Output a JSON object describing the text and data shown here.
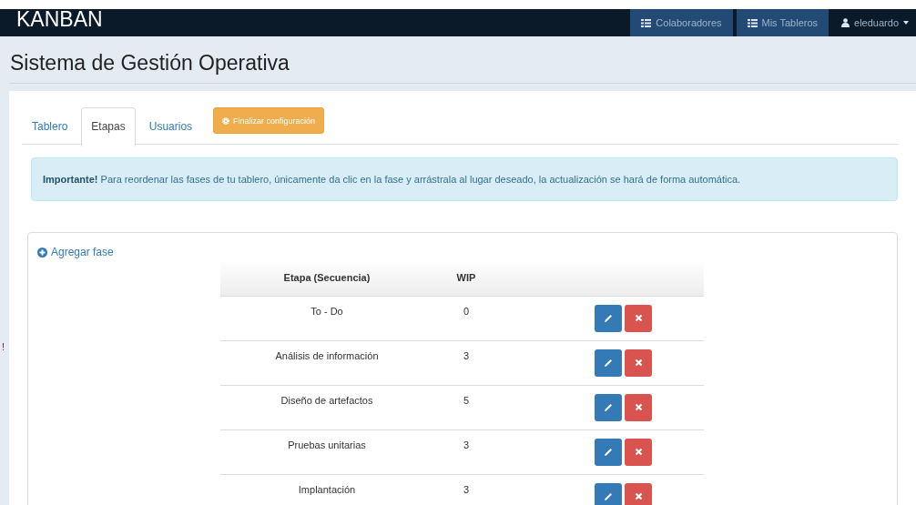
{
  "navbar": {
    "brand": "KANBAN",
    "links": [
      {
        "label": "Colaboradores",
        "kind": "list"
      },
      {
        "label": "Mis Tableros",
        "kind": "list"
      },
      {
        "label": "eleduardo",
        "kind": "user"
      }
    ]
  },
  "page_title": "Sistema de Gestión Operativa",
  "tabs": [
    {
      "label": "Tablero",
      "selected": false
    },
    {
      "label": "Etapas",
      "selected": true
    },
    {
      "label": "Usuarios",
      "selected": false
    }
  ],
  "finish_button": "Finalizar configuración",
  "alert": "**Importante!** Para reordenar las fases de tu tablero, únicamente da clic en la fase y arrástrala al lugar deseado, la actualización se hará de forma automática.",
  "stray_mark": "!",
  "add_phase": "Agregar fase",
  "table": {
    "columns": [
      "Etapa (Secuencia)",
      "WIP"
    ],
    "rows": [
      {
        "stage": "To - Do",
        "wip": "0"
      },
      {
        "stage": "Análisis de información",
        "wip": "3"
      },
      {
        "stage": "Diseño de artefactos",
        "wip": "5"
      },
      {
        "stage": "Pruebas unitarias",
        "wip": "3"
      },
      {
        "stage": "Implantación",
        "wip": "3"
      }
    ]
  }
}
